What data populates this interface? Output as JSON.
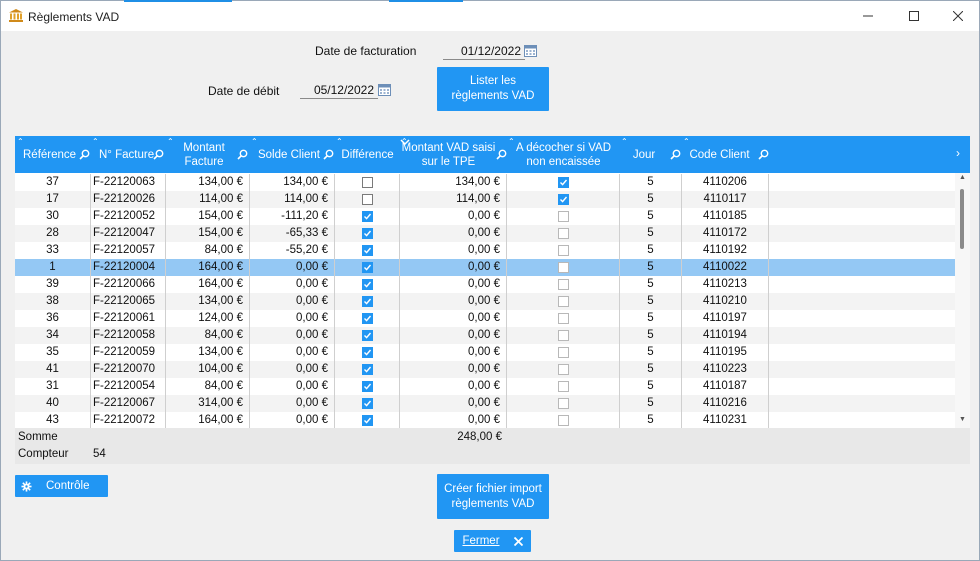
{
  "window": {
    "title": "Règlements VAD",
    "accent": "#2196f3"
  },
  "form": {
    "date_facturation_label": "Date de facturation",
    "date_facturation_value": "01/12/2022",
    "date_debit_label": "Date de débit",
    "date_debit_value": "05/12/2022",
    "list_button": "Lister les règlements VAD"
  },
  "grid": {
    "columns": {
      "reference": "Référence",
      "facture": "N° Facture",
      "montant_facture": "Montant Facture",
      "solde_client": "Solde Client",
      "difference": "Différence",
      "montant_vad": "Montant VAD saisi sur le TPE",
      "a_decocher": "A décocher si VAD non encaissée",
      "jour": "Jour",
      "code_client": "Code Client"
    },
    "rows": [
      {
        "ref": "37",
        "facture": "F-22120063",
        "montant": "134,00 €",
        "solde": "134,00 €",
        "difference": false,
        "vad": "134,00 €",
        "decocher": true,
        "jour": "5",
        "code": "4110206"
      },
      {
        "ref": "17",
        "facture": "F-22120026",
        "montant": "114,00 €",
        "solde": "114,00 €",
        "difference": false,
        "vad": "114,00 €",
        "decocher": true,
        "jour": "5",
        "code": "4110117"
      },
      {
        "ref": "30",
        "facture": "F-22120052",
        "montant": "154,00 €",
        "solde": "-111,20 €",
        "difference": true,
        "vad": "0,00 €",
        "decocher": false,
        "jour": "5",
        "code": "4110185"
      },
      {
        "ref": "28",
        "facture": "F-22120047",
        "montant": "154,00 €",
        "solde": "-65,33 €",
        "difference": true,
        "vad": "0,00 €",
        "decocher": false,
        "jour": "5",
        "code": "4110172"
      },
      {
        "ref": "33",
        "facture": "F-22120057",
        "montant": "84,00 €",
        "solde": "-55,20 €",
        "difference": true,
        "vad": "0,00 €",
        "decocher": false,
        "jour": "5",
        "code": "4110192"
      },
      {
        "ref": "1",
        "facture": "F-22120004",
        "montant": "164,00 €",
        "solde": "0,00 €",
        "difference": true,
        "vad": "0,00 €",
        "decocher": false,
        "jour": "5",
        "code": "4110022",
        "selected": true
      },
      {
        "ref": "39",
        "facture": "F-22120066",
        "montant": "164,00 €",
        "solde": "0,00 €",
        "difference": true,
        "vad": "0,00 €",
        "decocher": false,
        "jour": "5",
        "code": "4110213"
      },
      {
        "ref": "38",
        "facture": "F-22120065",
        "montant": "134,00 €",
        "solde": "0,00 €",
        "difference": true,
        "vad": "0,00 €",
        "decocher": false,
        "jour": "5",
        "code": "4110210"
      },
      {
        "ref": "36",
        "facture": "F-22120061",
        "montant": "124,00 €",
        "solde": "0,00 €",
        "difference": true,
        "vad": "0,00 €",
        "decocher": false,
        "jour": "5",
        "code": "4110197"
      },
      {
        "ref": "34",
        "facture": "F-22120058",
        "montant": "84,00 €",
        "solde": "0,00 €",
        "difference": true,
        "vad": "0,00 €",
        "decocher": false,
        "jour": "5",
        "code": "4110194"
      },
      {
        "ref": "35",
        "facture": "F-22120059",
        "montant": "134,00 €",
        "solde": "0,00 €",
        "difference": true,
        "vad": "0,00 €",
        "decocher": false,
        "jour": "5",
        "code": "4110195"
      },
      {
        "ref": "41",
        "facture": "F-22120070",
        "montant": "104,00 €",
        "solde": "0,00 €",
        "difference": true,
        "vad": "0,00 €",
        "decocher": false,
        "jour": "5",
        "code": "4110223"
      },
      {
        "ref": "31",
        "facture": "F-22120054",
        "montant": "84,00 €",
        "solde": "0,00 €",
        "difference": true,
        "vad": "0,00 €",
        "decocher": false,
        "jour": "5",
        "code": "4110187"
      },
      {
        "ref": "40",
        "facture": "F-22120067",
        "montant": "314,00 €",
        "solde": "0,00 €",
        "difference": true,
        "vad": "0,00 €",
        "decocher": false,
        "jour": "5",
        "code": "4110216"
      },
      {
        "ref": "43",
        "facture": "F-22120072",
        "montant": "164,00 €",
        "solde": "0,00 €",
        "difference": true,
        "vad": "0,00 €",
        "decocher": false,
        "jour": "5",
        "code": "4110231"
      }
    ],
    "footer": {
      "somme_label": "Somme",
      "somme_vad": "248,00 €",
      "compteur_label": "Compteur",
      "compteur_value": "54"
    }
  },
  "actions": {
    "controle": "Contrôle",
    "creer": "Créer fichier import règlements VAD",
    "fermer": "Fermer"
  }
}
